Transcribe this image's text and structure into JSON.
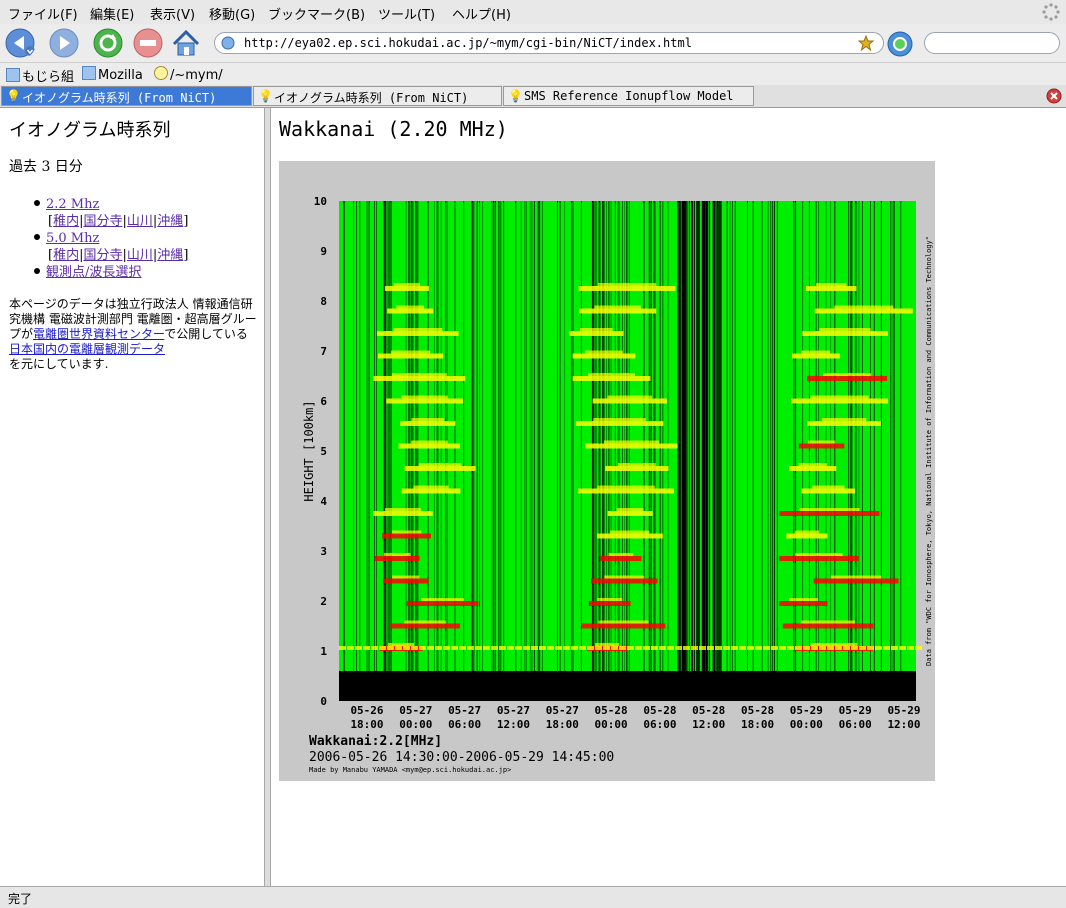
{
  "menu": [
    "ファイル(F)",
    "編集(E)",
    "表示(V)",
    "移動(G)",
    "ブックマーク(B)",
    "ツール(T)",
    "ヘルプ(H)"
  ],
  "nav": {
    "url": "http://eya02.ep.sci.hokudai.ac.jp/~mym/cgi-bin/NiCT/index.html",
    "search_value": ""
  },
  "bookmarks": [
    "もじら組",
    "Mozilla",
    "/~mym/"
  ],
  "tabs": [
    "イオノグラム時系列 (From NiCT)",
    "イオノグラム時系列 (From NiCT)",
    "SMS Reference Ionupflow Model"
  ],
  "sidebar": {
    "title": "イオノグラム時系列",
    "subtitle": "過去 3 日分",
    "items": [
      {
        "label": "2.2 Mhz",
        "stations": [
          "稚内",
          "国分寺",
          "山川",
          "沖縄"
        ]
      },
      {
        "label": "5.0 Mhz",
        "stations": [
          "稚内",
          "国分寺",
          "山川",
          "沖縄"
        ]
      },
      {
        "label": "観測点/波長選択"
      }
    ],
    "note_1": "本ページのデータは独立行政法人 情報通信研究機構 電磁波計測部門 電離圏・超高層グループが",
    "note_link_1": "電離圏世界資料センター",
    "note_2": "で公開している ",
    "note_link_2": "日本国内の電離層観測データ",
    "note_3": "を元にしています."
  },
  "main": {
    "title": "Wakkanai (2.20 MHz)"
  },
  "chart_data": {
    "type": "heatmap",
    "ylabel": "HEIGHT [100km]",
    "ylim": [
      0,
      10
    ],
    "yticks": [
      "0",
      "1",
      "2",
      "3",
      "4",
      "5",
      "6",
      "7",
      "8",
      "9",
      "10"
    ],
    "xticks": [
      [
        "05-26",
        "18:00"
      ],
      [
        "05-27",
        "00:00"
      ],
      [
        "05-27",
        "06:00"
      ],
      [
        "05-27",
        "12:00"
      ],
      [
        "05-27",
        "18:00"
      ],
      [
        "05-28",
        "00:00"
      ],
      [
        "05-28",
        "06:00"
      ],
      [
        "05-28",
        "12:00"
      ],
      [
        "05-28",
        "18:00"
      ],
      [
        "05-29",
        "00:00"
      ],
      [
        "05-29",
        "06:00"
      ],
      [
        "05-29",
        "12:00"
      ]
    ],
    "station_label": "Wakkanai:2.2[MHz]",
    "time_range": "2006-05-26 14:30:00-2006-05-29 14:45:00",
    "credit": "Made by Manabu YAMADA <mym@ep.sci.hokudai.ac.jp>",
    "source": "Data from \"WDC for Ionosphere, Tokyo, National Institute of Information and Communications Technology\"",
    "colors": {
      "background": "#00ff00",
      "weak": "#ffff00",
      "strong": "#ff0000",
      "noise": "#000000"
    }
  },
  "status": {
    "text": "完了"
  }
}
